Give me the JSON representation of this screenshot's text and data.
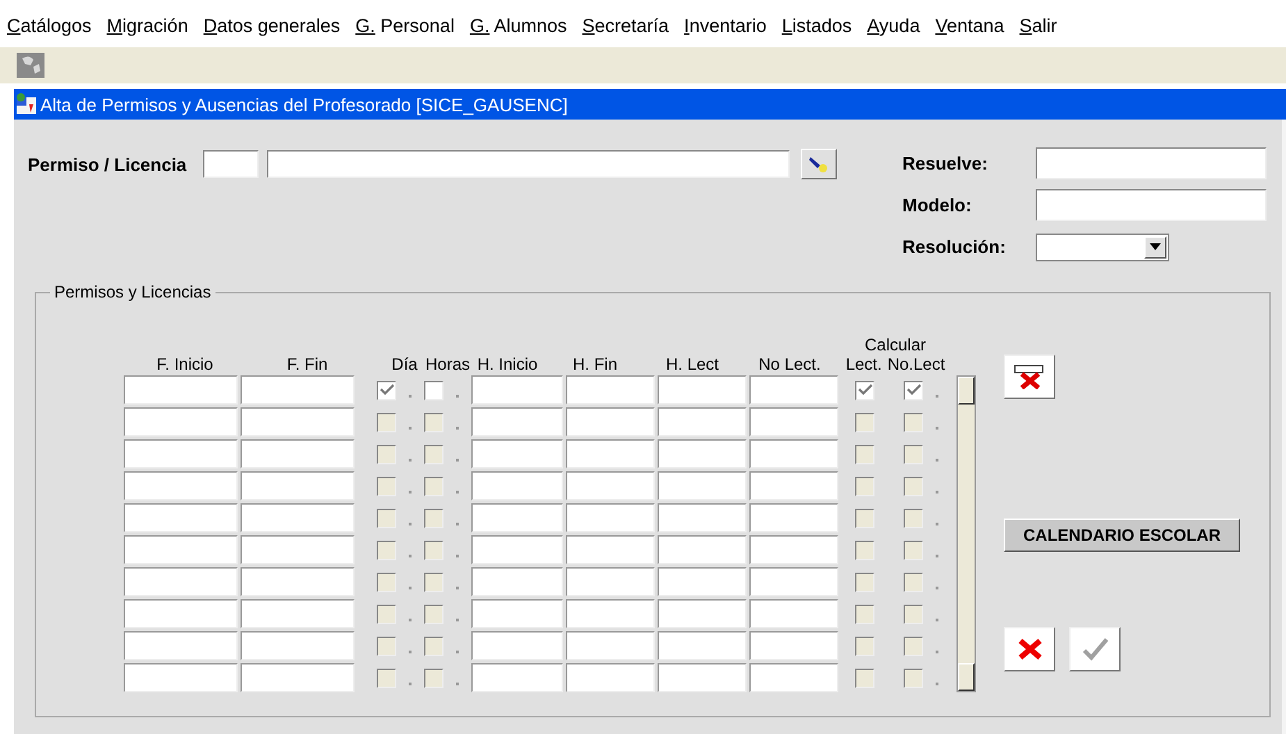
{
  "menu": [
    "Catálogos",
    "Migración",
    "Datos generales",
    "G. Personal",
    "G. Alumnos",
    "Secretaría",
    "Inventario",
    "Listados",
    "Ayuda",
    "Ventana",
    "Salir"
  ],
  "window": {
    "title": "Alta de Permisos y Ausencias del Profesorado [SICE_GAUSENC]"
  },
  "form": {
    "permiso_label": "Permiso / Licencia",
    "resuelve_label": "Resuelve:",
    "modelo_label": "Modelo:",
    "resolucion_label": "Resolución:"
  },
  "group": {
    "title": "Permisos y Licencias",
    "calcular": "Calcular",
    "columns": [
      "F. Inicio",
      "F. Fin",
      "Día",
      "Horas",
      "H. Inicio",
      "H. Fin",
      "H. Lect",
      "No Lect.",
      "Lect.",
      "No.Lect"
    ],
    "rows": [
      {
        "disabled": false,
        "dia": true,
        "horas": false,
        "lect": true,
        "no_lect": true
      },
      {
        "disabled": true,
        "dia": false,
        "horas": false,
        "lect": false,
        "no_lect": false
      },
      {
        "disabled": true,
        "dia": false,
        "horas": false,
        "lect": false,
        "no_lect": false
      },
      {
        "disabled": true,
        "dia": false,
        "horas": false,
        "lect": false,
        "no_lect": false
      },
      {
        "disabled": true,
        "dia": false,
        "horas": false,
        "lect": false,
        "no_lect": false
      },
      {
        "disabled": true,
        "dia": false,
        "horas": false,
        "lect": false,
        "no_lect": false
      },
      {
        "disabled": true,
        "dia": false,
        "horas": false,
        "lect": false,
        "no_lect": false
      },
      {
        "disabled": true,
        "dia": false,
        "horas": false,
        "lect": false,
        "no_lect": false
      },
      {
        "disabled": true,
        "dia": false,
        "horas": false,
        "lect": false,
        "no_lect": false
      },
      {
        "disabled": true,
        "dia": false,
        "horas": false,
        "lect": false,
        "no_lect": false
      }
    ]
  },
  "calendar_button": "CALENDARIO ESCOLAR",
  "accept_disabled": true
}
